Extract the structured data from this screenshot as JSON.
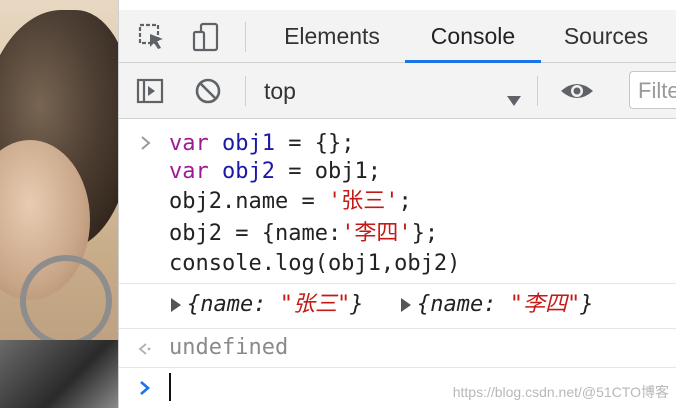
{
  "devtools": {
    "tabs": [
      {
        "label": "Elements"
      },
      {
        "label": "Console"
      },
      {
        "label": "Sources"
      }
    ],
    "active_tab": "Console",
    "accent_color": "#1a73e8"
  },
  "toolbar": {
    "context_value": "top",
    "filter_placeholder": "Filte"
  },
  "console": {
    "input_lines": [
      {
        "kw": "var",
        "name": "obj1",
        "rest": " = {};"
      },
      {
        "kw": "var",
        "name": "obj2",
        "rest": " = obj1;"
      },
      {
        "pre": "obj2.name = ",
        "str": "'张三'",
        "post": ";"
      },
      {
        "pre": "obj2 = {name:",
        "str": "'李四'",
        "post": "};"
      },
      {
        "text": "console.log(obj1,obj2)"
      }
    ],
    "output_objects": [
      {
        "open": "{name: ",
        "value": "\"张三\"",
        "close": "}"
      },
      {
        "open": "{name: ",
        "value": "\"李四\"",
        "close": "}"
      }
    ],
    "result": "undefined"
  },
  "watermark": "https://blog.csdn.net/@51CTO博客"
}
